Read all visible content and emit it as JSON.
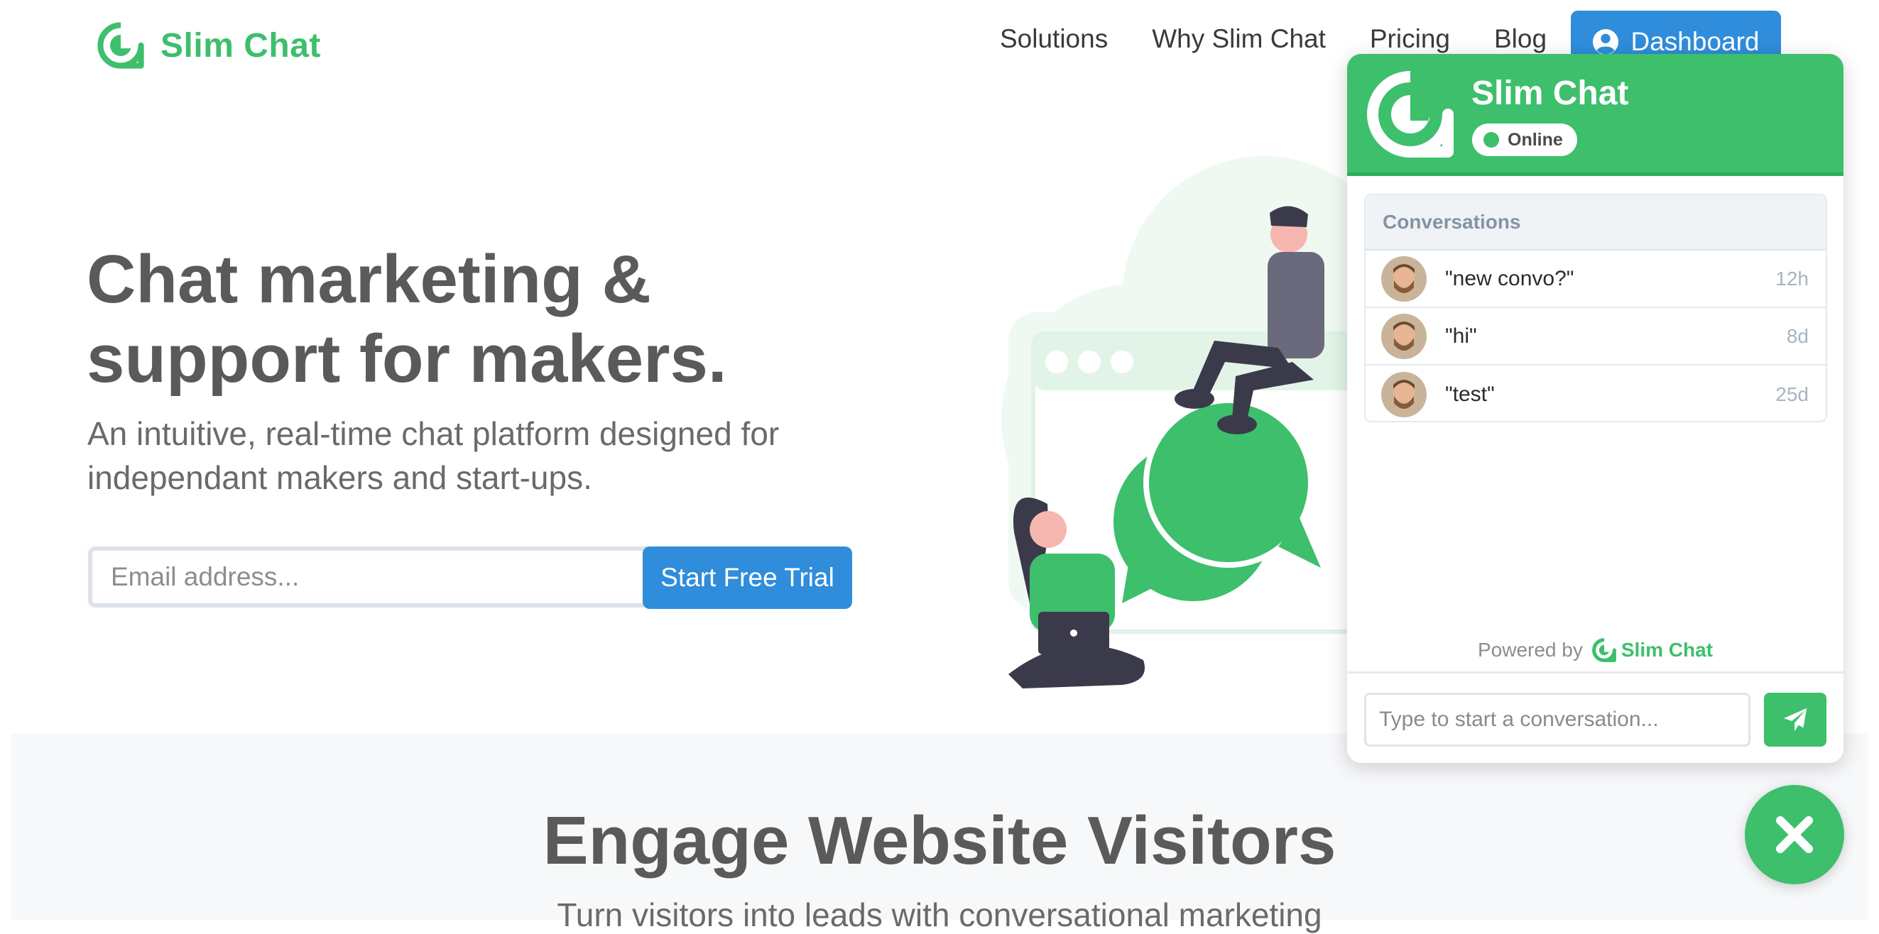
{
  "brand": {
    "name": "Slim Chat",
    "color": "#3dbf6c"
  },
  "nav": {
    "items": [
      "Solutions",
      "Why Slim Chat",
      "Pricing",
      "Blog"
    ],
    "dashboard_label": "Dashboard",
    "dashboard_icon": "user-circle-icon"
  },
  "hero": {
    "title": "Chat marketing & support for makers.",
    "subtitle": "An intuitive, real-time chat platform designed for independant makers and start-ups.",
    "email_placeholder": "Email address...",
    "cta_label": "Start Free Trial"
  },
  "section2": {
    "title": "Engage Website Visitors",
    "subtitle": "Turn visitors into leads with conversational marketing"
  },
  "widget": {
    "title": "Slim Chat",
    "status": "Online",
    "conversations_header": "Conversations",
    "conversations": [
      {
        "message": "\"new convo?\"",
        "time": "12h"
      },
      {
        "message": "\"hi\"",
        "time": "8d"
      },
      {
        "message": "\"test\"",
        "time": "25d"
      }
    ],
    "powered_by": "Powered by",
    "powered_brand": "Slim Chat",
    "input_placeholder": "Type to start a conversation...",
    "send_icon": "paper-plane-icon",
    "close_icon": "close-icon"
  },
  "colors": {
    "accent_green": "#3dbf6c",
    "button_blue": "#2f8ddb",
    "heading_gray": "#5a5a5a"
  }
}
